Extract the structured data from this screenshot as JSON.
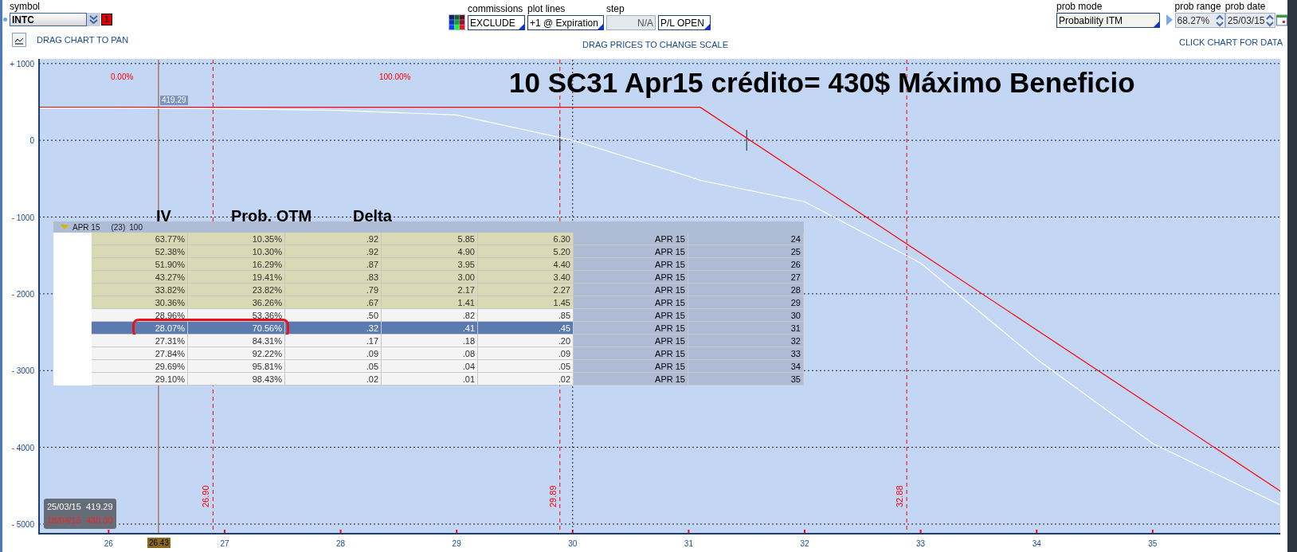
{
  "toolbar": {
    "symbol": {
      "label": "symbol",
      "value": "INTC",
      "badge": "1"
    },
    "pan_hint": "DRAG CHART TO PAN",
    "selects": [
      {
        "label": "commissions",
        "value": "EXCLUDE",
        "kind": "select",
        "disabled": false
      },
      {
        "label": "plot lines",
        "value": "+1 @ Expiration",
        "kind": "select",
        "disabled": false
      },
      {
        "label": "step",
        "value": "N/A",
        "kind": "field",
        "disabled": true
      },
      {
        "value": "P/L OPEN",
        "kind": "select",
        "disabled": false
      }
    ],
    "scale_hint": "DRAG PRICES TO CHANGE SCALE",
    "prob_mode": {
      "label": "prob mode",
      "value": "Probability ITM"
    },
    "prob_range": {
      "label": "prob range",
      "value": "68.27%"
    },
    "prob_date": {
      "label": "prob date",
      "value": "25/03/15"
    },
    "data_hint": "CLICK CHART FOR DATA"
  },
  "chart": {
    "title": "10 SC31 Apr15 crédito= 430$ Máximo Beneficio",
    "chart_data": {
      "type": "line",
      "xlim": [
        25.4,
        36.1
      ],
      "ylim": [
        -5125,
        1060
      ],
      "grid": true,
      "xticks": [
        26,
        27,
        28,
        29,
        30,
        31,
        32,
        33,
        34,
        35
      ],
      "yticks": [
        {
          "value": 1000,
          "label": "+ 1000"
        },
        {
          "value": 0,
          "label": "0"
        },
        {
          "value": -1000,
          "label": "- 1000"
        },
        {
          "value": -2000,
          "label": "- 2000"
        },
        {
          "value": -3000,
          "label": "- 3000"
        },
        {
          "value": -4000,
          "label": "- 4000"
        },
        {
          "value": -5000,
          "label": "- 5000"
        }
      ],
      "x": [
        25.4,
        26,
        27,
        28,
        29,
        30,
        31,
        31.1,
        32,
        33,
        34,
        35,
        36.1
      ],
      "series": [
        {
          "color": "#ff0000",
          "values": [
            430,
            430,
            430,
            430,
            430,
            430,
            430,
            430,
            -470,
            -1470,
            -2470,
            -3470,
            -4570
          ]
        },
        {
          "color": "#ffffff",
          "values": [
            420,
            420,
            410,
            390,
            330,
            0,
            -470,
            -520,
            -800,
            -1600,
            -2850,
            -3950,
            -4750
          ]
        }
      ],
      "ref_lines": [
        {
          "axis": "x",
          "value": 26.43,
          "label": "26.43",
          "color": "#8a5020"
        },
        {
          "axis": "x",
          "value": 26.9,
          "label": "26.90",
          "color": "#ff0000"
        },
        {
          "axis": "x",
          "value": 29.89,
          "label": "29.89",
          "color": "#ff0000"
        },
        {
          "axis": "x",
          "value": 32.88,
          "label": "32.88",
          "color": "#ff0000"
        },
        {
          "axis": "x",
          "value": 30,
          "color": "#202020"
        }
      ],
      "annotations": [
        "0.00%",
        "100.00%",
        "419.29"
      ]
    },
    "tooltip": [
      {
        "text": "25/03/15  419.29",
        "color": "#ffffff"
      },
      {
        "text": "18/04/15  430.00",
        "color": "#ff2020"
      }
    ]
  },
  "chain": {
    "group": {
      "expiry": "APR 15",
      "days": "(23)",
      "multiplier": "100",
      "expanded": true
    },
    "headings": [
      "IV",
      "Prob. OTM",
      "Delta"
    ],
    "rows": [
      {
        "iv": "63.77%",
        "prob_otm": "10.35%",
        "delta": ".92",
        "column_4": "5.85",
        "column_5": "6.30",
        "expiry": "APR 15",
        "strike": "24",
        "in_the_money": true,
        "selected": false,
        "circled": false
      },
      {
        "iv": "52.38%",
        "prob_otm": "10.30%",
        "delta": ".92",
        "column_4": "4.90",
        "column_5": "5.20",
        "expiry": "APR 15",
        "strike": "25",
        "in_the_money": true,
        "selected": false,
        "circled": false
      },
      {
        "iv": "51.90%",
        "prob_otm": "16.29%",
        "delta": ".87",
        "column_4": "3.95",
        "column_5": "4.40",
        "expiry": "APR 15",
        "strike": "26",
        "in_the_money": true,
        "selected": false,
        "circled": false
      },
      {
        "iv": "43.27%",
        "prob_otm": "19.41%",
        "delta": ".83",
        "column_4": "3.00",
        "column_5": "3.40",
        "expiry": "APR 15",
        "strike": "27",
        "in_the_money": true,
        "selected": false,
        "circled": false
      },
      {
        "iv": "33.82%",
        "prob_otm": "23.82%",
        "delta": ".79",
        "column_4": "2.17",
        "column_5": "2.27",
        "expiry": "APR 15",
        "strike": "28",
        "in_the_money": true,
        "selected": false,
        "circled": false
      },
      {
        "iv": "30.36%",
        "prob_otm": "36.26%",
        "delta": ".67",
        "column_4": "1.41",
        "column_5": "1.45",
        "expiry": "APR 15",
        "strike": "29",
        "in_the_money": true,
        "selected": false,
        "circled": false
      },
      {
        "iv": "28.96%",
        "prob_otm": "53.36%",
        "delta": ".50",
        "column_4": ".82",
        "column_5": ".85",
        "expiry": "APR 15",
        "strike": "30",
        "in_the_money": false,
        "selected": false,
        "circled": false
      },
      {
        "iv": "28.07%",
        "prob_otm": "70.56%",
        "delta": ".32",
        "column_4": ".41",
        "column_5": ".45",
        "expiry": "APR 15",
        "strike": "31",
        "in_the_money": false,
        "selected": true,
        "circled": true
      },
      {
        "iv": "27.31%",
        "prob_otm": "84.31%",
        "delta": ".17",
        "column_4": ".18",
        "column_5": ".20",
        "expiry": "APR 15",
        "strike": "32",
        "in_the_money": false,
        "selected": false,
        "circled": false
      },
      {
        "iv": "27.84%",
        "prob_otm": "92.22%",
        "delta": ".09",
        "column_4": ".08",
        "column_5": ".09",
        "expiry": "APR 15",
        "strike": "33",
        "in_the_money": false,
        "selected": false,
        "circled": false
      },
      {
        "iv": "29.69%",
        "prob_otm": "95.81%",
        "delta": ".05",
        "column_4": ".04",
        "column_5": ".05",
        "expiry": "APR 15",
        "strike": "34",
        "in_the_money": false,
        "selected": false,
        "circled": false
      },
      {
        "iv": "29.10%",
        "prob_otm": "98.43%",
        "delta": ".02",
        "column_4": ".01",
        "column_5": ".02",
        "expiry": "APR 15",
        "strike": "35",
        "in_the_money": false,
        "selected": false,
        "circled": false
      }
    ]
  }
}
